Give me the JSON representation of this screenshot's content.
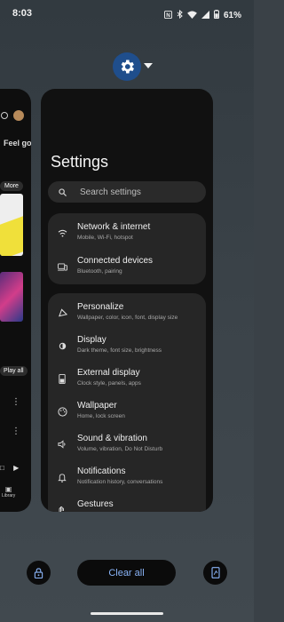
{
  "status_bar": {
    "time": "8:03",
    "battery": "61%",
    "icons": [
      "nfc-icon",
      "bluetooth-icon",
      "wifi-icon",
      "signal-icon",
      "battery-icon"
    ]
  },
  "app_header": {
    "icon": "settings-gear-icon",
    "menu": "chevron-down-icon",
    "accent": "#1f4e8c"
  },
  "left_card": {
    "title": "Feel goo",
    "more_label": "More",
    "play_all_label": "Play all",
    "library_label": "Library"
  },
  "settings": {
    "title": "Settings",
    "search_placeholder": "Search settings",
    "group1": [
      {
        "icon": "wifi-icon",
        "title": "Network & internet",
        "subtitle": "Mobile, Wi-Fi, hotspot"
      },
      {
        "icon": "devices-icon",
        "title": "Connected devices",
        "subtitle": "Bluetooth, pairing"
      }
    ],
    "group2": [
      {
        "icon": "personalize-icon",
        "title": "Personalize",
        "subtitle": "Wallpaper, color, icon, font, display size"
      },
      {
        "icon": "display-icon",
        "title": "Display",
        "subtitle": "Dark theme, font size, brightness"
      },
      {
        "icon": "external-display-icon",
        "title": "External display",
        "subtitle": "Clock style, panels, apps"
      },
      {
        "icon": "palette-icon",
        "title": "Wallpaper",
        "subtitle": "Home, lock screen"
      },
      {
        "icon": "volume-icon",
        "title": "Sound & vibration",
        "subtitle": "Volume, vibration, Do Not Disturb"
      },
      {
        "icon": "bell-icon",
        "title": "Notifications",
        "subtitle": "Notification history, conversations"
      },
      {
        "icon": "gestures-icon",
        "title": "Gestures",
        "subtitle": ""
      }
    ]
  },
  "bottom": {
    "clear_all_label": "Clear all",
    "accent": "#8ab4f8"
  }
}
